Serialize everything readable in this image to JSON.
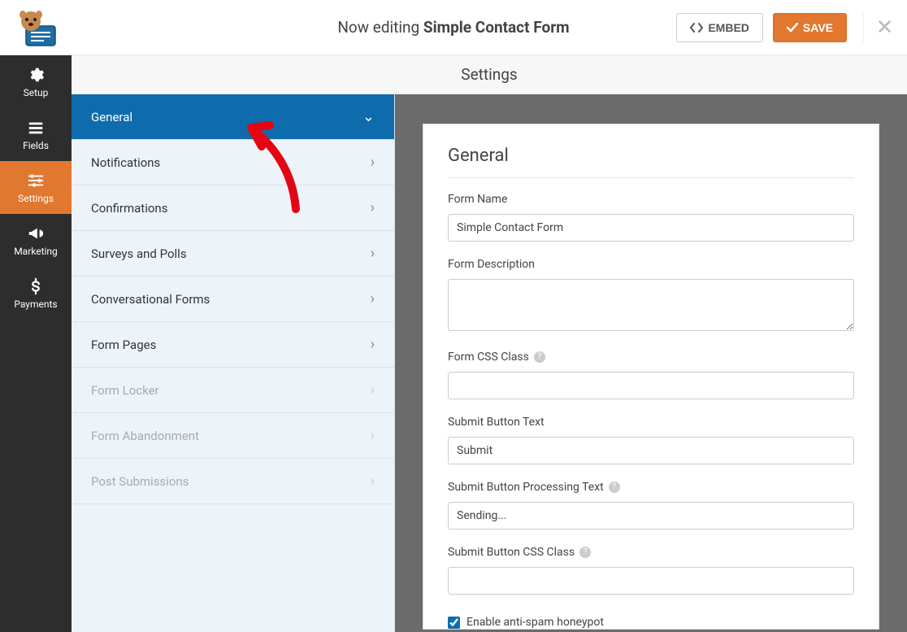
{
  "header": {
    "editing_prefix": "Now editing ",
    "form_title": "Simple Contact Form",
    "embed_label": "EMBED",
    "save_label": "SAVE"
  },
  "left_nav": [
    {
      "id": "setup",
      "label": "Setup"
    },
    {
      "id": "fields",
      "label": "Fields"
    },
    {
      "id": "settings",
      "label": "Settings"
    },
    {
      "id": "marketing",
      "label": "Marketing"
    },
    {
      "id": "payments",
      "label": "Payments"
    }
  ],
  "content_header": "Settings",
  "settings_menu": [
    {
      "label": "General",
      "active": true,
      "chev": "down"
    },
    {
      "label": "Notifications",
      "active": false,
      "chev": "right"
    },
    {
      "label": "Confirmations",
      "active": false,
      "chev": "right"
    },
    {
      "label": "Surveys and Polls",
      "active": false,
      "chev": "right"
    },
    {
      "label": "Conversational Forms",
      "active": false,
      "chev": "right"
    },
    {
      "label": "Form Pages",
      "active": false,
      "chev": "right"
    },
    {
      "label": "Form Locker",
      "active": false,
      "chev": "right",
      "disabled": true
    },
    {
      "label": "Form Abandonment",
      "active": false,
      "chev": "right",
      "disabled": true
    },
    {
      "label": "Post Submissions",
      "active": false,
      "chev": "right",
      "disabled": true
    }
  ],
  "panel": {
    "heading": "General",
    "form_name_label": "Form Name",
    "form_name_value": "Simple Contact Form",
    "form_description_label": "Form Description",
    "form_description_value": "",
    "form_css_label": "Form CSS Class",
    "form_css_value": "",
    "submit_text_label": "Submit Button Text",
    "submit_text_value": "Submit",
    "submit_processing_label": "Submit Button Processing Text",
    "submit_processing_value": "Sending...",
    "submit_css_label": "Submit Button CSS Class",
    "submit_css_value": "",
    "honeypot_label": "Enable anti-spam honeypot",
    "honeypot_checked": true
  }
}
